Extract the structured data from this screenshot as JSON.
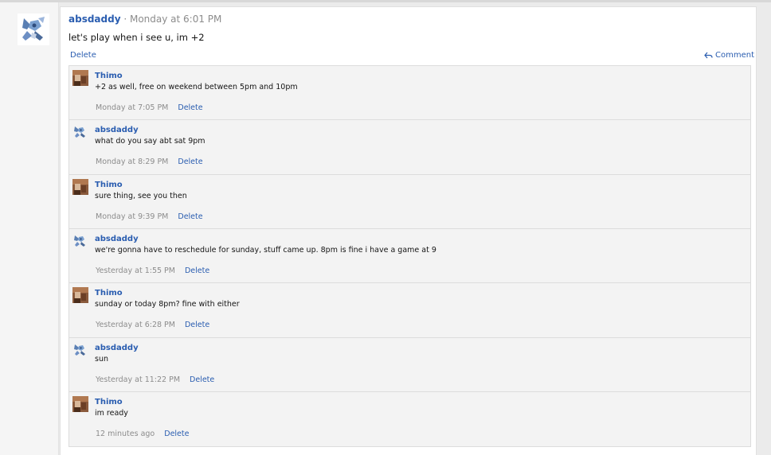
{
  "post": {
    "author": "absdaddy",
    "separator": " · ",
    "time": "Monday at 6:01 PM",
    "body": "let's play when i see u, im +2",
    "delete_label": "Delete",
    "comment_label": "Comment"
  },
  "replies": [
    {
      "author": "Thimo",
      "avatar": "thimo-avatar",
      "text": "+2 as well, free on weekend between 5pm and 10pm",
      "time": "Monday at 7:05 PM",
      "delete_label": "Delete"
    },
    {
      "author": "absdaddy",
      "avatar": "absdaddy-avatar",
      "text": "what do you say abt sat 9pm",
      "time": "Monday at 8:29 PM",
      "delete_label": "Delete"
    },
    {
      "author": "Thimo",
      "avatar": "thimo-avatar",
      "text": "sure thing, see you then",
      "time": "Monday at 9:39 PM",
      "delete_label": "Delete"
    },
    {
      "author": "absdaddy",
      "avatar": "absdaddy-avatar",
      "text": "we're gonna have to reschedule for sunday, stuff came up. 8pm is fine i have a game at 9",
      "time": "Yesterday at 1:55 PM",
      "delete_label": "Delete"
    },
    {
      "author": "Thimo",
      "avatar": "thimo-avatar",
      "text": "sunday or today 8pm? fine with either",
      "time": "Yesterday at 6:28 PM",
      "delete_label": "Delete"
    },
    {
      "author": "absdaddy",
      "avatar": "absdaddy-avatar",
      "text": "sun",
      "time": "Yesterday at 11:22 PM",
      "delete_label": "Delete"
    },
    {
      "author": "Thimo",
      "avatar": "thimo-avatar",
      "text": "im ready",
      "time": "12 minutes ago",
      "delete_label": "Delete"
    }
  ],
  "colors": {
    "link": "#2a5db0",
    "muted": "#8c8c8c",
    "reply_bg": "#f3f3f3"
  }
}
